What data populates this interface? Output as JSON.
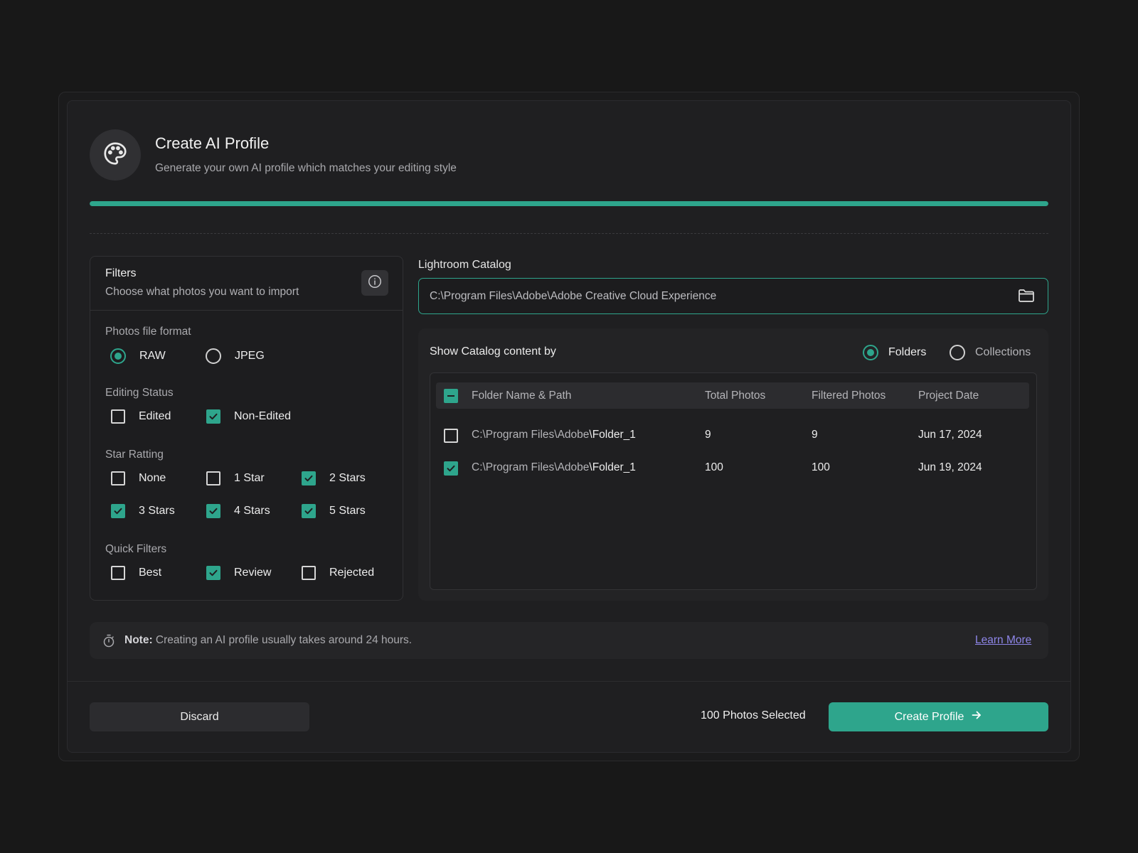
{
  "header": {
    "title": "Create AI Profile",
    "subtitle": "Generate your own AI profile which matches your editing style",
    "icon": "palette-icon",
    "progress_fraction": 1.0
  },
  "filters": {
    "title": "Filters",
    "description": "Choose what photos you want to import",
    "file_format": {
      "label": "Photos file format",
      "options": [
        {
          "label": "RAW",
          "selected": true
        },
        {
          "label": "JPEG",
          "selected": false
        }
      ]
    },
    "editing_status": {
      "label": "Editing Status",
      "options": [
        {
          "label": "Edited",
          "checked": false
        },
        {
          "label": "Non-Edited",
          "checked": true
        }
      ]
    },
    "star_rating": {
      "label": "Star Ratting",
      "options": [
        {
          "label": "None",
          "checked": false
        },
        {
          "label": "1 Star",
          "checked": false
        },
        {
          "label": "2 Stars",
          "checked": true
        },
        {
          "label": "3 Stars",
          "checked": true
        },
        {
          "label": "4 Stars",
          "checked": true
        },
        {
          "label": "5 Stars",
          "checked": true
        }
      ]
    },
    "quick_filters": {
      "label": "Quick Filters",
      "options": [
        {
          "label": "Best",
          "checked": false
        },
        {
          "label": "Review",
          "checked": true
        },
        {
          "label": "Rejected",
          "checked": false
        }
      ]
    }
  },
  "catalog": {
    "label": "Lightroom Catalog",
    "path_value": "C:\\Program Files\\Adobe\\Adobe Creative Cloud Experience",
    "show_by_label": "Show Catalog content by",
    "view_options": [
      {
        "label": "Folders",
        "selected": true
      },
      {
        "label": "Collections",
        "selected": false
      }
    ],
    "table": {
      "columns": [
        "Folder Name & Path",
        "Total Photos",
        "Filtered Photos",
        "Project Date"
      ],
      "rows": [
        {
          "path_prefix": "C:\\Program Files\\Adobe",
          "folder": "\\Folder_1",
          "total": "9",
          "filtered": "9",
          "date": "Jun 17, 2024",
          "checked": false
        },
        {
          "path_prefix": "C:\\Program Files\\Adobe",
          "folder": "\\Folder_1",
          "total": "100",
          "filtered": "100",
          "date": "Jun 19, 2024",
          "checked": true
        }
      ]
    }
  },
  "note": {
    "prefix": "Note:",
    "text": " Creating an AI profile usually takes around 24 hours.",
    "link": "Learn More"
  },
  "footer": {
    "discard_label": "Discard",
    "selected_text": "100 Photos Selected",
    "create_label": "Create Profile"
  },
  "colors": {
    "accent": "#2ea58c",
    "link": "#8e86e8",
    "background": "#181818",
    "panel": "#1f1f21"
  }
}
